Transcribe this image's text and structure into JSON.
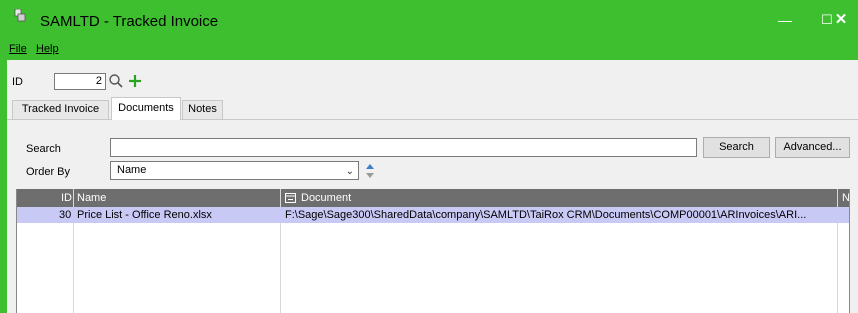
{
  "window": {
    "title": "SAMLTD - Tracked Invoice",
    "controls": {
      "minimize": "—",
      "maximize": "☐",
      "close": "✕"
    }
  },
  "menu": {
    "file": "File",
    "help": "Help"
  },
  "id_row": {
    "label": "ID",
    "value": "2"
  },
  "tabs": [
    {
      "label": "Tracked Invoice"
    },
    {
      "label": "Documents"
    },
    {
      "label": "Notes"
    }
  ],
  "search": {
    "label": "Search",
    "value": "",
    "button": "Search",
    "advanced_button": "Advanced..."
  },
  "order_by": {
    "label": "Order By",
    "value": "Name"
  },
  "grid": {
    "columns": {
      "id": "ID",
      "name": "Name",
      "document": "Document",
      "extra": "N"
    },
    "rows": [
      {
        "id": "30",
        "name": "Price List - Office Reno.xlsx",
        "document": "F:\\Sage\\Sage300\\SharedData\\company\\SAMLTD\\TaiRox CRM\\Documents\\COMP00001\\ARInvoices\\ARI..."
      }
    ]
  },
  "colors": {
    "frame": "#3dbf2f",
    "grid_header": "#6e6e6e",
    "selected_row": "#c9c9f6"
  }
}
